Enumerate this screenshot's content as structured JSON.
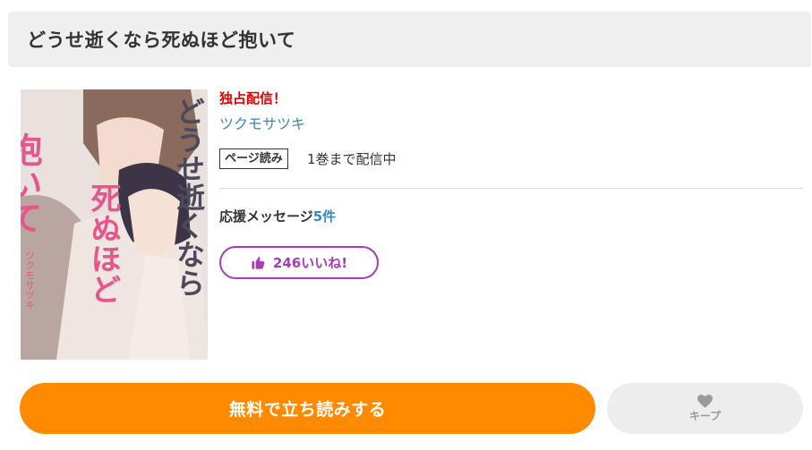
{
  "title": "どうせ逝くなら死ぬほど抱いて",
  "cover": {
    "title_art_line_1": "抱いて",
    "title_art_line_2": "どうせ逝くなら",
    "title_art_line_3": "死ぬほど",
    "author_art": "ツクモサツキ"
  },
  "info": {
    "exclusive_label": "独占配信！",
    "author": "ツクモサツキ",
    "badge": "ページ読み",
    "volume_status": "1巻まで配信中",
    "message_label": "応援メッセージ",
    "message_count": "5件",
    "like_label": "246いいね!"
  },
  "actions": {
    "read_label": "無料で立ち読みする",
    "keep_label": "キープ"
  },
  "colors": {
    "accent_orange": "#ff8a00",
    "like_purple": "#a63cb7",
    "link_blue": "#3a86c5",
    "exclusive_red": "#e00000"
  }
}
